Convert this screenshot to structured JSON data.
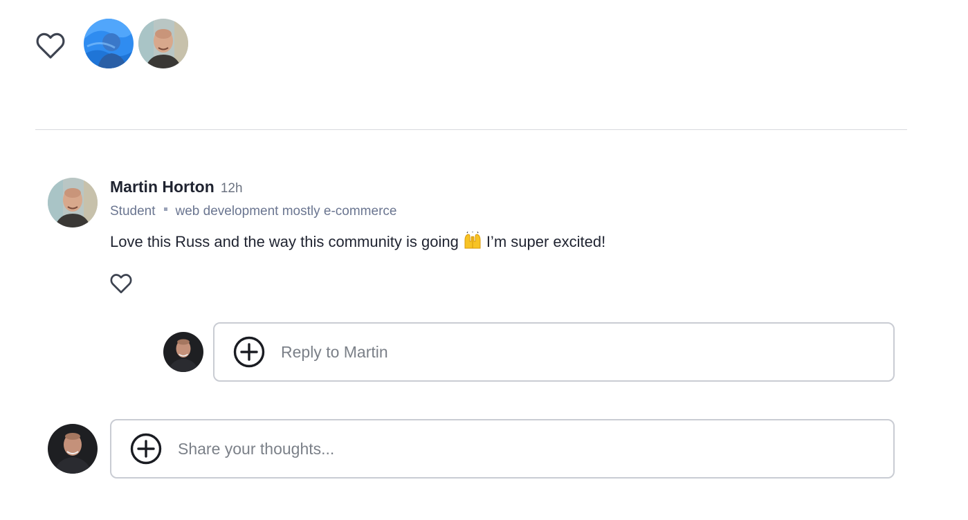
{
  "post": {
    "like_icon": "heart-outline-icon",
    "likers": [
      {
        "avatar": "avatar-blue-photo"
      },
      {
        "avatar": "avatar-martin-horton"
      }
    ]
  },
  "comment": {
    "author": "Martin Horton",
    "time": "12h",
    "role": "Student",
    "bio": "web development mostly e-commerce",
    "text_before": "Love this Russ and the way this community is going",
    "emoji": "🙌",
    "text_after": "I’m super excited!",
    "like_icon": "heart-outline-icon"
  },
  "reply": {
    "placeholder": "Reply to Martin",
    "add_icon": "plus-circle-icon"
  },
  "new_comment": {
    "placeholder": "Share your thoughts...",
    "add_icon": "plus-circle-icon"
  },
  "colors": {
    "text": "#1f2330",
    "meta": "#6a7590",
    "border": "#c9ccd3",
    "divider": "#d7d9de"
  }
}
